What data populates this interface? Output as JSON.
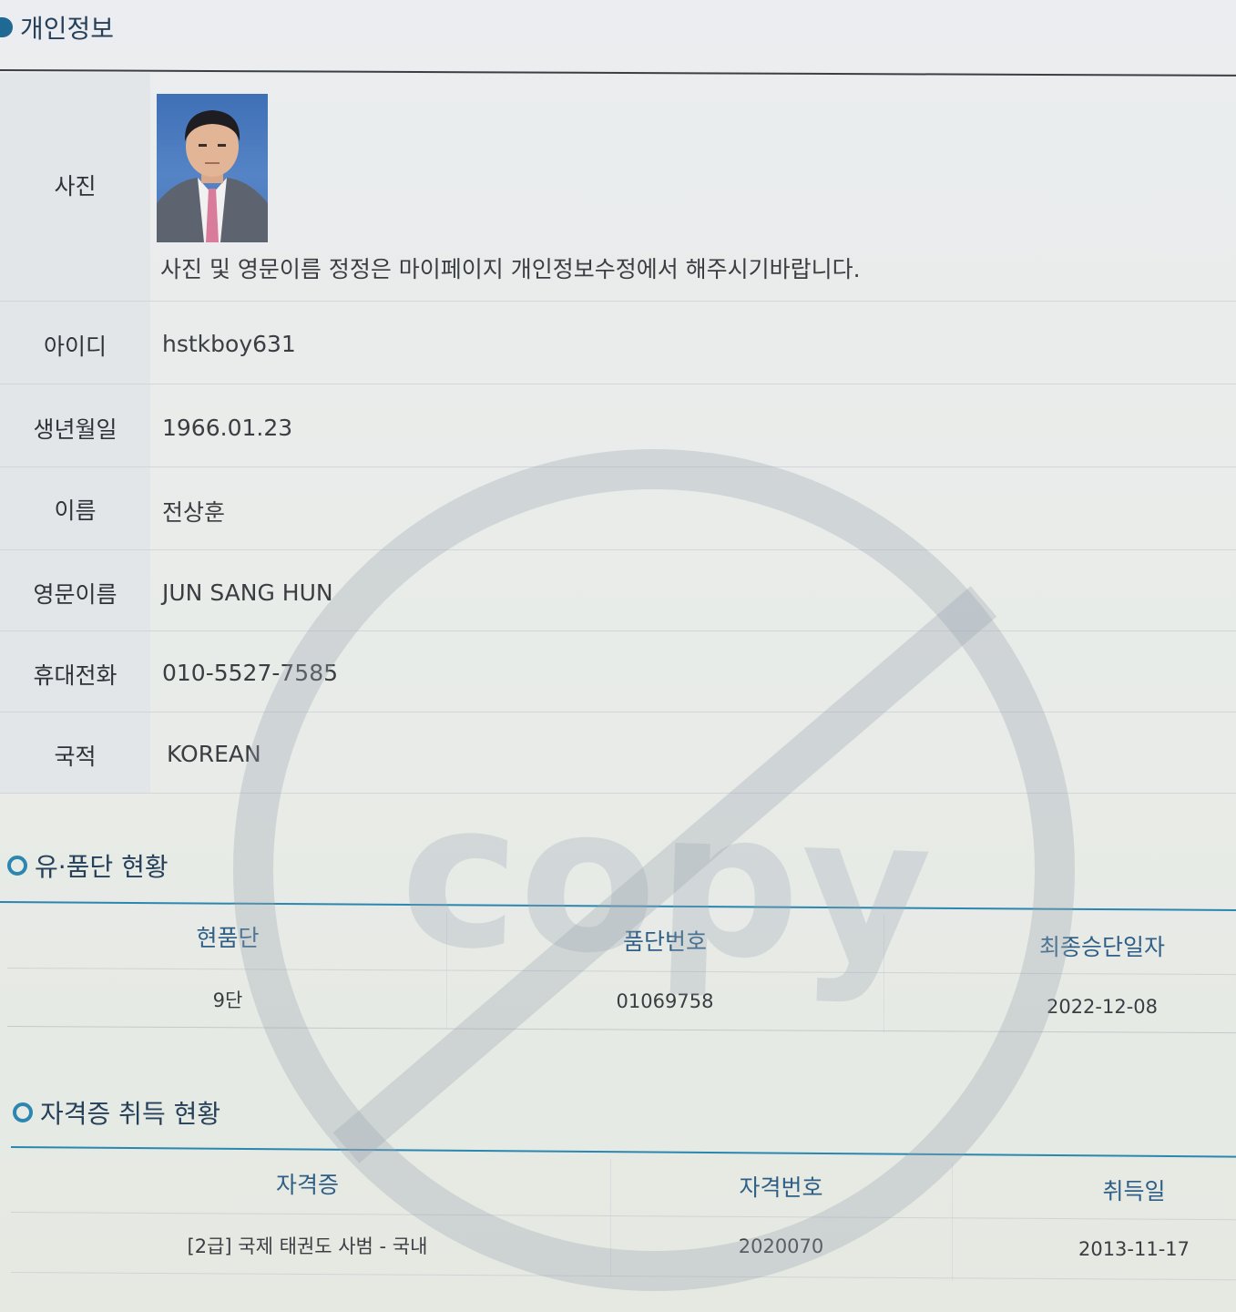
{
  "personal": {
    "title": "개인정보",
    "photo_label": "사진",
    "photo_note": "사진 및 영문이름 정정은 마이페이지 개인정보수정에서 해주시기바랍니다.",
    "rows": [
      {
        "label": "아이디",
        "value": "hstkboy631"
      },
      {
        "label": "생년월일",
        "value": "1966.01.23"
      },
      {
        "label": "이름",
        "value": "전상훈"
      },
      {
        "label": "영문이름",
        "value": "JUN SANG HUN"
      },
      {
        "label": "휴대전화",
        "value": "010-5527-7585"
      },
      {
        "label": "국적",
        "value": "KOREAN"
      }
    ]
  },
  "dan": {
    "title": "유·품단 현황",
    "headers": [
      "현품단",
      "품단번호",
      "최종승단일자"
    ],
    "row": [
      "9단",
      "01069758",
      "2022-12-08"
    ]
  },
  "cert": {
    "title": "자격증 취득 현황",
    "headers": [
      "자격증",
      "자격번호",
      "취득일"
    ],
    "row": [
      "[2급] 국제 태권도 사범 - 국내",
      "2020070",
      "2013-11-17"
    ]
  },
  "watermark": {
    "text": "copy"
  },
  "colors": {
    "accent": "#2b86b0",
    "heading_text": "#27405a",
    "table_header_text": "#2f5f86",
    "watermark": "#9aa6b2"
  }
}
